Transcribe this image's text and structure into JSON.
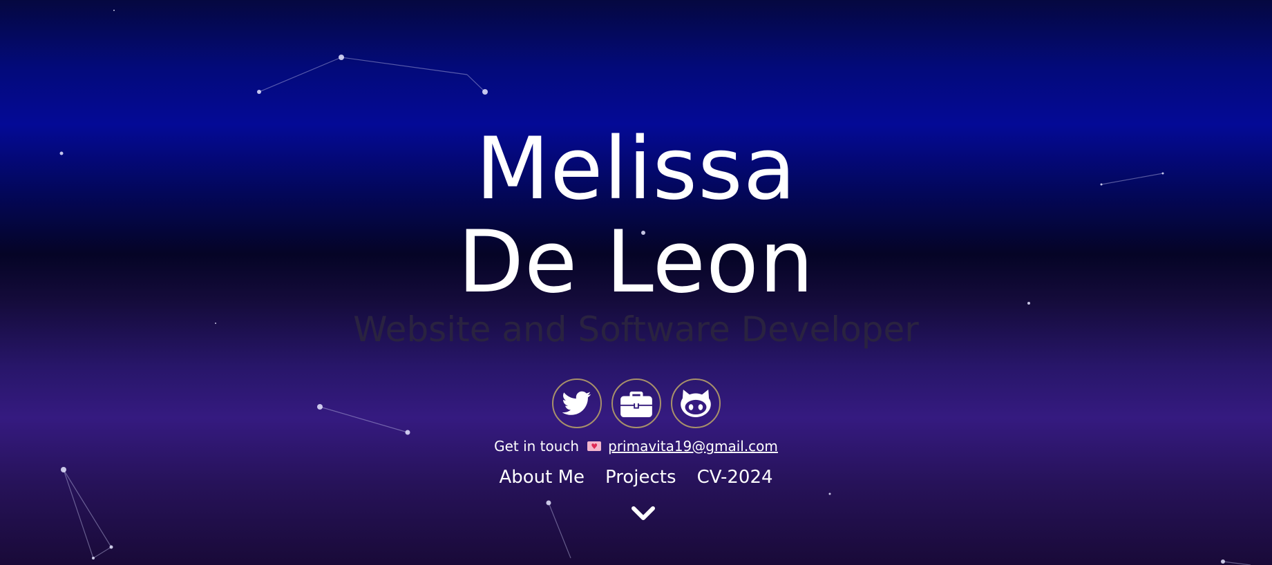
{
  "hero": {
    "name_first": "Melissa",
    "name_last": "De Leon",
    "subtitle": "Website and Software Developer"
  },
  "social": [
    {
      "icon": "twitter-icon"
    },
    {
      "icon": "briefcase-icon"
    },
    {
      "icon": "github-icon"
    }
  ],
  "contact": {
    "label": "Get in touch",
    "icon": "envelope-heart-icon",
    "email": "primavita19@gmail.com"
  },
  "nav": {
    "items": [
      "About Me",
      "Projects",
      "CV-2024"
    ]
  },
  "scroll": {
    "icon": "chevron-down-icon"
  },
  "colors": {
    "text": "#ffffff",
    "subtitle": "#2a2340",
    "button_border": "#a8916a",
    "background_top": "#030a7a",
    "background_bottom": "#351a80"
  }
}
